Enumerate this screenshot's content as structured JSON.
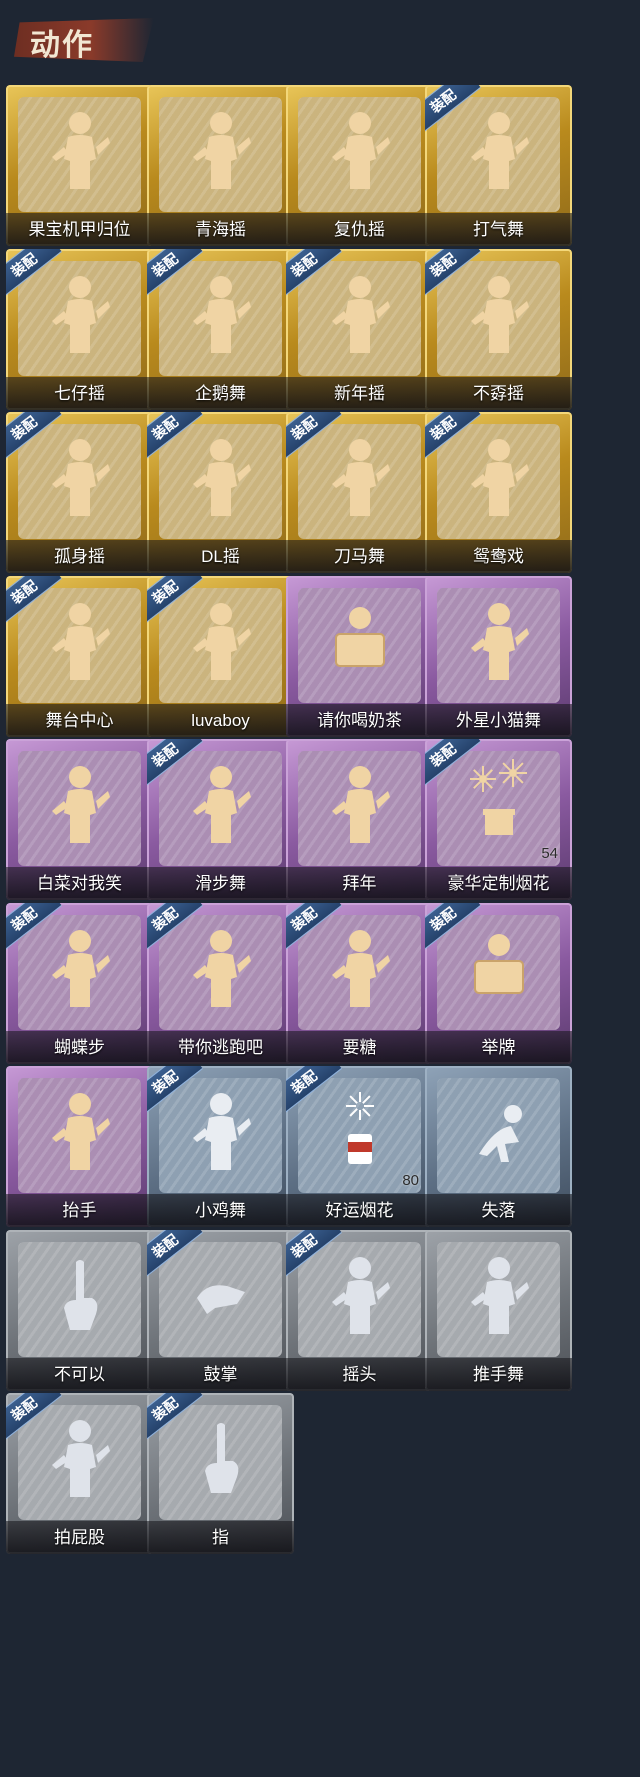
{
  "header": {
    "title": "动作"
  },
  "equip_badge": "装配",
  "cards": [
    {
      "label": "果宝机甲归位",
      "tier": "gold",
      "equipped": false,
      "icon": "dance-pose-icon"
    },
    {
      "label": "青海摇",
      "tier": "gold",
      "equipped": false,
      "icon": "dance-pose-icon"
    },
    {
      "label": "复仇摇",
      "tier": "gold",
      "equipped": false,
      "icon": "dance-pose-icon"
    },
    {
      "label": "打气舞",
      "tier": "gold",
      "equipped": true,
      "icon": "dance-pose-icon"
    },
    {
      "label": "七仔摇",
      "tier": "gold",
      "equipped": true,
      "icon": "dance-pose-icon"
    },
    {
      "label": "企鹅舞",
      "tier": "gold",
      "equipped": true,
      "icon": "dance-pose-icon"
    },
    {
      "label": "新年摇",
      "tier": "gold",
      "equipped": true,
      "icon": "dance-pose-icon"
    },
    {
      "label": "不孬摇",
      "tier": "gold",
      "equipped": true,
      "icon": "dance-pose-icon"
    },
    {
      "label": "孤身摇",
      "tier": "gold",
      "equipped": true,
      "icon": "dance-pose-icon"
    },
    {
      "label": "DL摇",
      "tier": "gold",
      "equipped": true,
      "icon": "dance-pose-icon"
    },
    {
      "label": "刀马舞",
      "tier": "gold",
      "equipped": true,
      "icon": "dance-pose-icon"
    },
    {
      "label": "鸳鸯戏",
      "tier": "gold",
      "equipped": true,
      "icon": "dance-pose-icon"
    },
    {
      "label": "舞台中心",
      "tier": "gold",
      "equipped": true,
      "icon": "dance-pose-icon"
    },
    {
      "label": "luvaboy",
      "tier": "gold",
      "equipped": true,
      "icon": "dance-pose-icon"
    },
    {
      "label": "请你喝奶茶",
      "tier": "purple",
      "equipped": false,
      "icon": "sign-holding-icon"
    },
    {
      "label": "外星小猫舞",
      "tier": "purple",
      "equipped": false,
      "icon": "dance-pose-icon"
    },
    {
      "label": "白菜对我笑",
      "tier": "purple",
      "equipped": false,
      "icon": "dance-pose-icon"
    },
    {
      "label": "滑步舞",
      "tier": "purple",
      "equipped": true,
      "icon": "dance-pose-icon"
    },
    {
      "label": "拜年",
      "tier": "purple",
      "equipped": false,
      "icon": "bow-pose-icon"
    },
    {
      "label": "豪华定制烟花",
      "tier": "purple",
      "equipped": true,
      "icon": "fireworks-box-icon",
      "count": "54"
    },
    {
      "label": "蝴蝶步",
      "tier": "purple",
      "equipped": true,
      "icon": "dance-pose-icon"
    },
    {
      "label": "带你逃跑吧",
      "tier": "purple",
      "equipped": true,
      "icon": "dance-pose-icon"
    },
    {
      "label": "要糖",
      "tier": "purple",
      "equipped": true,
      "icon": "dance-pose-icon"
    },
    {
      "label": "举牌",
      "tier": "purple",
      "equipped": true,
      "icon": "sign-holding-icon"
    },
    {
      "label": "抬手",
      "tier": "purple",
      "equipped": false,
      "icon": "dance-pose-icon"
    },
    {
      "label": "小鸡舞",
      "tier": "blue",
      "equipped": true,
      "icon": "dance-pose-icon"
    },
    {
      "label": "好运烟花",
      "tier": "blue",
      "equipped": true,
      "icon": "firework-can-icon",
      "count": "80"
    },
    {
      "label": "失落",
      "tier": "blue",
      "equipped": false,
      "icon": "crawl-pose-icon"
    },
    {
      "label": "不可以",
      "tier": "grey",
      "equipped": false,
      "icon": "finger-wag-icon"
    },
    {
      "label": "鼓掌",
      "tier": "grey",
      "equipped": true,
      "icon": "clap-hands-icon"
    },
    {
      "label": "摇头",
      "tier": "grey",
      "equipped": true,
      "icon": "dance-pose-icon"
    },
    {
      "label": "推手舞",
      "tier": "grey",
      "equipped": false,
      "icon": "dance-pose-icon"
    },
    {
      "label": "拍屁股",
      "tier": "grey",
      "equipped": true,
      "icon": "dance-pose-icon"
    },
    {
      "label": "指",
      "tier": "grey",
      "equipped": true,
      "icon": "pointing-hand-icon"
    }
  ]
}
